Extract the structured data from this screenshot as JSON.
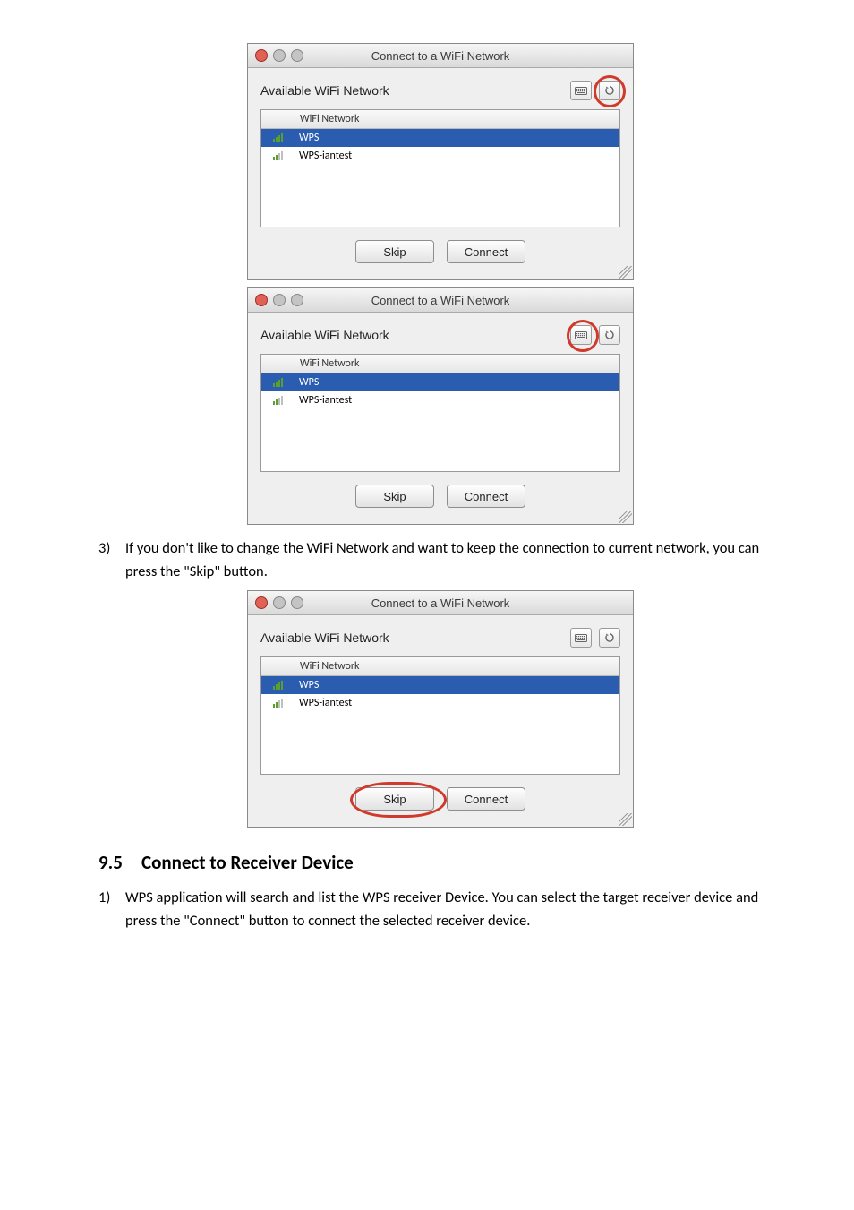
{
  "dialog": {
    "title": "Connect to a WiFi Network",
    "available_label": "Available WiFi Network",
    "table": {
      "header_name": "WiFi Network",
      "rows": [
        {
          "name": "WPS",
          "selected": true,
          "signal": "green"
        },
        {
          "name": "WPS-iantest",
          "selected": false,
          "signal": "mix"
        }
      ]
    },
    "buttons": {
      "skip": "Skip",
      "connect": "Connect"
    }
  },
  "para3": {
    "num": "3)",
    "text": "If you don't like to change the WiFi Network and want to keep the connection to current network, you can press the \"Skip\" button."
  },
  "heading": {
    "num": "9.5",
    "text": "Connect to Receiver Device"
  },
  "para1": {
    "num": "1)",
    "text": "WPS application will search and list the WPS receiver Device. You can select the target receiver device and press the \"Connect\" button to connect the selected receiver device."
  }
}
